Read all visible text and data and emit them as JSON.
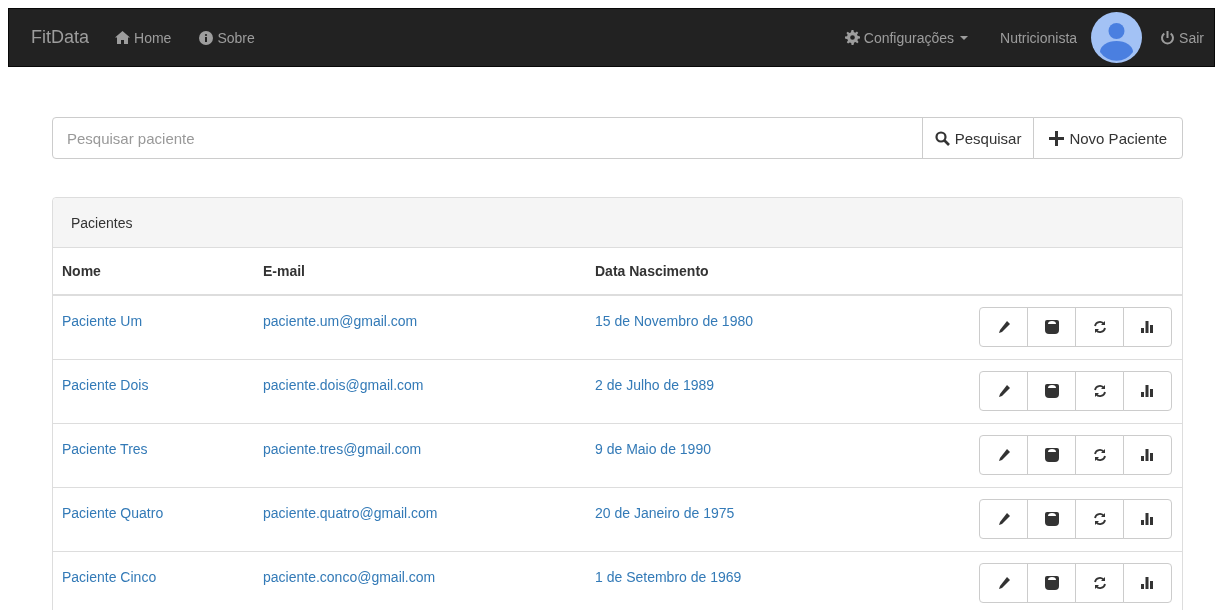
{
  "navbar": {
    "brand": "FitData",
    "links": [
      {
        "label": "Home"
      },
      {
        "label": "Sobre"
      }
    ],
    "right": [
      {
        "label": "Configurações",
        "kind": "dropdown"
      },
      {
        "label": "Nutricionista",
        "kind": "text"
      },
      {
        "kind": "avatar"
      },
      {
        "label": "Sair",
        "kind": "link"
      }
    ]
  },
  "search": {
    "placeholder": "Pesquisar paciente",
    "buttons": [
      {
        "label": "Pesquisar"
      },
      {
        "label": "Novo Paciente"
      }
    ]
  },
  "panel": {
    "title": "Pacientes",
    "columns": [
      "Nome",
      "E-mail",
      "Data Nascimento"
    ],
    "rows": [
      {
        "name": "Paciente Um",
        "email": "paciente.um@gmail.com",
        "birth": "15 de Novembro de 1980"
      },
      {
        "name": "Paciente Dois",
        "email": "paciente.dois@gmail.com",
        "birth": "2 de Julho de 1989"
      },
      {
        "name": "Paciente Tres",
        "email": "paciente.tres@gmail.com",
        "birth": "9 de Maio de 1990"
      },
      {
        "name": "Paciente Quatro",
        "email": "paciente.quatro@gmail.com",
        "birth": "20 de Janeiro de 1975"
      },
      {
        "name": "Paciente Cinco",
        "email": "paciente.conco@gmail.com",
        "birth": "1 de Setembro de 1969"
      }
    ]
  }
}
